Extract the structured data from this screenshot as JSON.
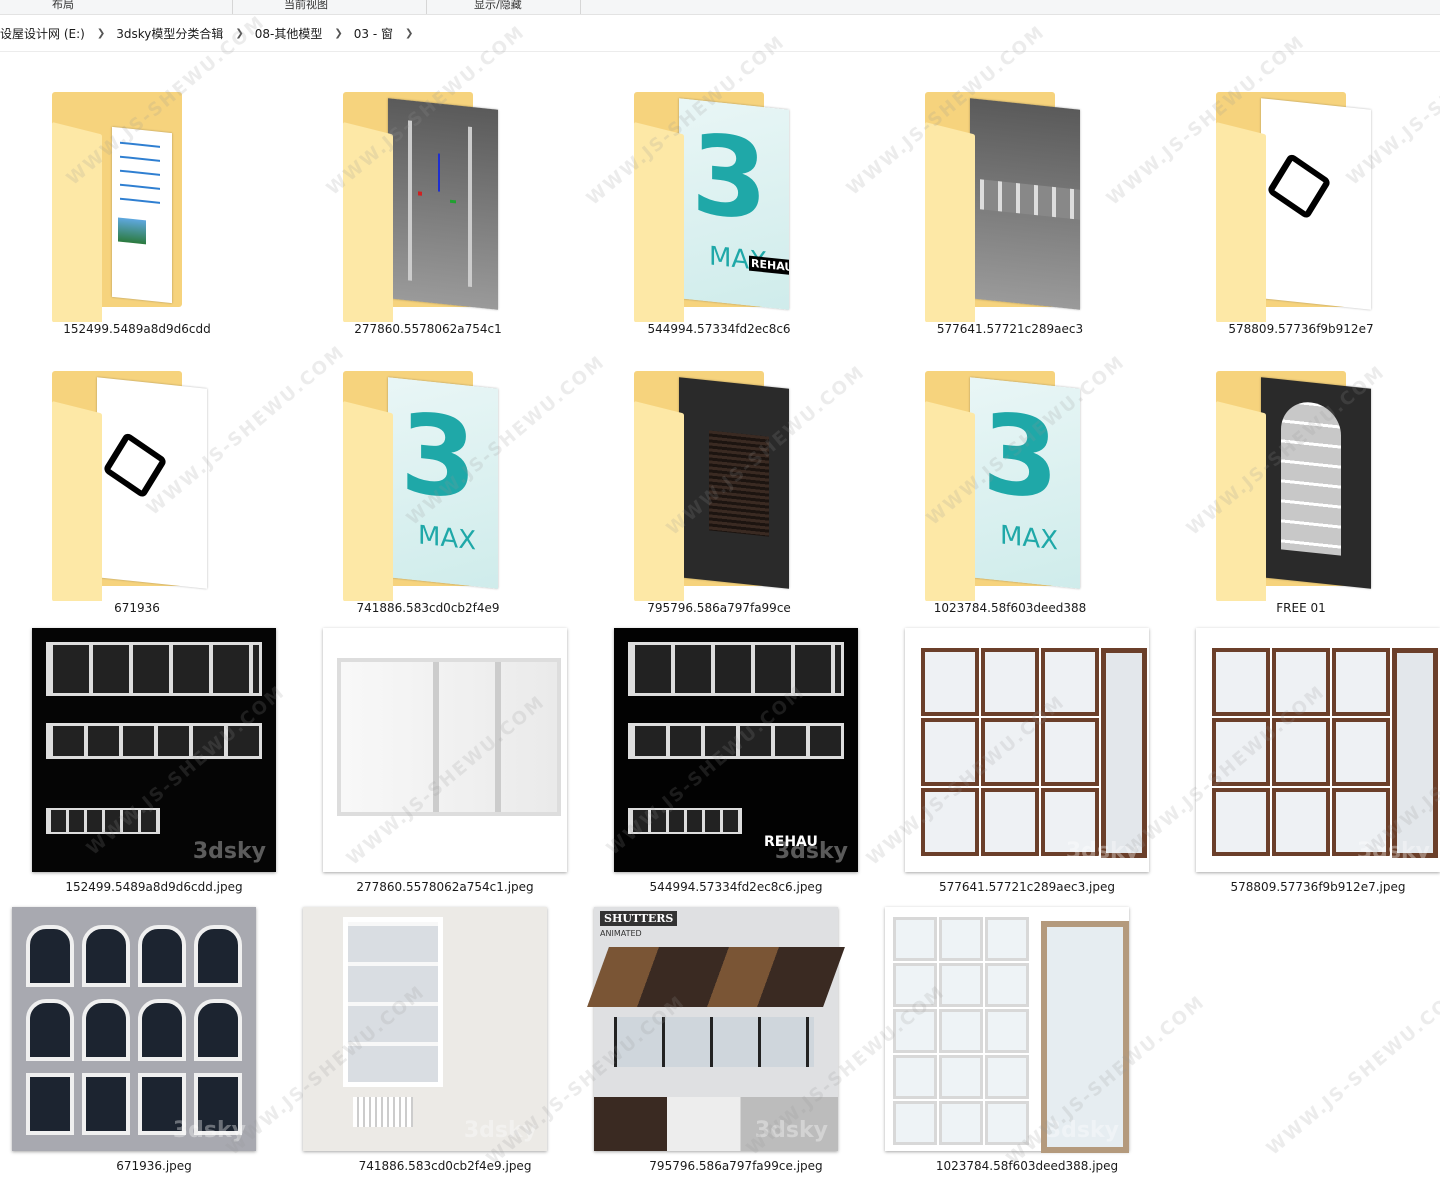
{
  "ribbon": {
    "labels": [
      "布局",
      "当前视图",
      "显示/隐藏"
    ]
  },
  "breadcrumb": [
    "设屋设计网 (E:)",
    "3dsky模型分类合辑",
    "08-其他模型",
    "03 - 窗"
  ],
  "folders": [
    {
      "name": "152499.5489a8d9d6cdd",
      "preview": "document"
    },
    {
      "name": "277860.5578062a754c1",
      "preview": "gray-render"
    },
    {
      "name": "544994.57334fd2ec8c6",
      "preview": "3dsmax-logo"
    },
    {
      "name": "577641.57721c289aec3",
      "preview": "gray-render"
    },
    {
      "name": "578809.57736f9b912e7",
      "preview": "model-file"
    },
    {
      "name": "671936",
      "preview": "model-file"
    },
    {
      "name": "741886.583cd0cb2f4e9",
      "preview": "3dsmax-logo"
    },
    {
      "name": "795796.586a797fa99ce",
      "preview": "dark-render"
    },
    {
      "name": "1023784.58f603deed388",
      "preview": "3dsmax-logo"
    },
    {
      "name": "FREE 01",
      "preview": "dark-render"
    }
  ],
  "images": [
    {
      "name": "152499.5489a8d9d6cdd.jpeg",
      "style": "dark"
    },
    {
      "name": "277860.5578062a754c1.jpeg",
      "style": "light"
    },
    {
      "name": "544994.57334fd2ec8c6.jpeg",
      "style": "dark"
    },
    {
      "name": "577641.57721c289aec3.jpeg",
      "style": "wood"
    },
    {
      "name": "578809.57736f9b912e7.jpeg",
      "style": "wood"
    },
    {
      "name": "671936.jpeg",
      "style": "facade"
    },
    {
      "name": "741886.583cd0cb2f4e9.jpeg",
      "style": "room"
    },
    {
      "name": "795796.586a797fa99ce.jpeg",
      "style": "shutters"
    },
    {
      "name": "1023784.58f603deed388.jpeg",
      "style": "catalog"
    }
  ],
  "thumb_texts": {
    "max_label": "MAX",
    "three_label": "3",
    "rehau": "REHAU",
    "shutters_title": "SHUTTERS",
    "shutters_sub": "ANIMATED",
    "sky": "3dsky"
  },
  "colors": {
    "folder_back": "#f6d37d",
    "folder_front": "#fde8a6",
    "max_teal": "#1fa8a8",
    "wood": "#6b3f2a"
  }
}
